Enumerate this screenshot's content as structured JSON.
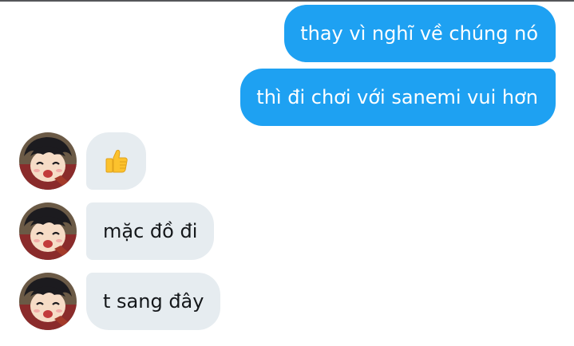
{
  "thread": {
    "outgoing": [
      {
        "text": "thay vì nghĩ về chúng nó"
      },
      {
        "text": "thì đi chơi với sanemi vui hơn"
      }
    ],
    "incoming": [
      {
        "text": "",
        "icon": "thumbs-up-emoji-icon"
      },
      {
        "text": "mặc đồ đi"
      },
      {
        "text": "t sang đây"
      }
    ]
  },
  "colors": {
    "outgoing_bubble": "#1ea1f2",
    "incoming_bubble": "#e6ecf0",
    "incoming_text": "#14171a"
  }
}
